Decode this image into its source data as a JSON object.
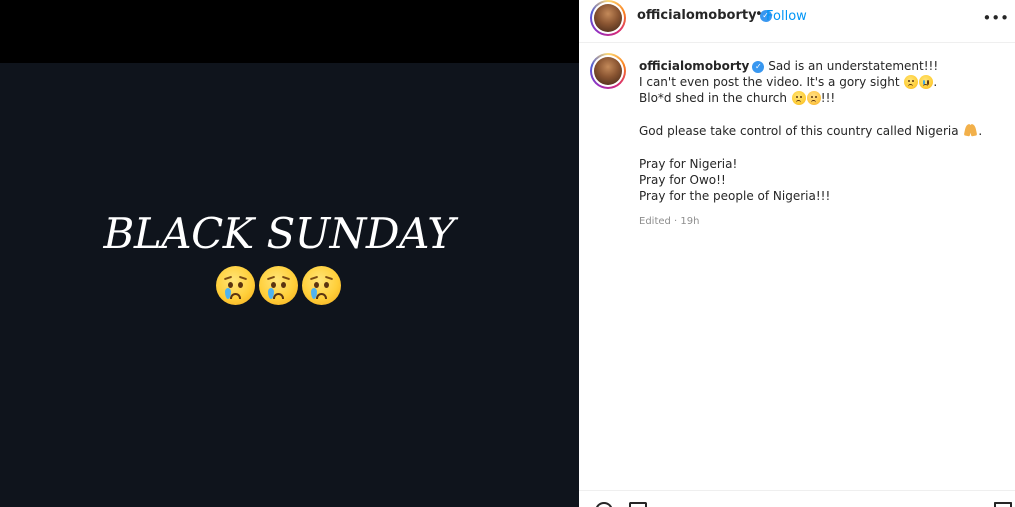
{
  "media": {
    "headline": "BLACK SUNDAY",
    "emoji_count": 3,
    "emoji_icon": "crying-face-icon",
    "background_color": "#0f141c"
  },
  "header": {
    "username": "officialomoborty",
    "separator": "•",
    "follow_label": "Follow",
    "more_icon": "more-options-icon",
    "follow_color": "#0095f6"
  },
  "caption": {
    "username": "officialomoborty",
    "lines": [
      "Sad is an understatement!!!",
      "I can't even post the video. It's a gory sight",
      "Blo*d shed in the church",
      "God please take control of this country called Nigeria",
      "Pray for Nigeria!",
      "Pray for Owo!!",
      "Pray for the people of Nigeria!!!"
    ],
    "line2_suffix": ".",
    "line3_suffix": "!!!",
    "line4_suffix": "."
  },
  "meta": {
    "edited": "Edited · 19h"
  }
}
